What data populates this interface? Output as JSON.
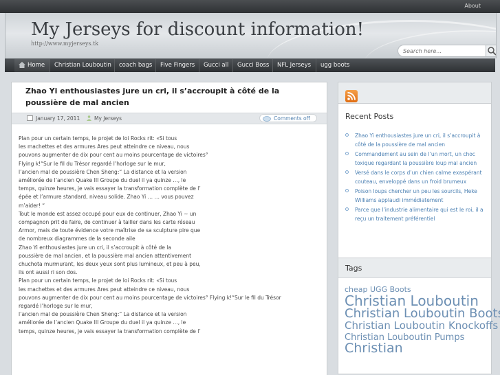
{
  "topbar": {
    "about_link": "About"
  },
  "header": {
    "title": "My Jerseys for discount information!",
    "url": "http://www.myjerseys.tk"
  },
  "search": {
    "placeholder": "Search here..."
  },
  "nav": {
    "items": [
      "Home",
      "Christian Louboutin",
      "coach bags",
      "Five Fingers",
      "Gucci all",
      "Gucci Boss",
      "NFL Jerseys",
      "ugg boots"
    ]
  },
  "post": {
    "title": "Zhao Yi enthousiastes jure un cri, il s’accroupit à côté de la poussière de mal ancien",
    "date": "January 17, 2011",
    "category": "My Jerseys",
    "comments": "Comments off",
    "body": [
      "Plan pour un certain temps, le projet de loi Rocks rit: «Si tous\nles machettes et des armures Ares peut atteindre ce niveau, nous\npouvons augmenter de dix pour cent au moins pourcentage de victoires°\nFlying k!“Sur le fil du Trésor regardé l’horloge sur le mur,\nl’ancien mal de poussière Chen Sheng:“ La distance et la version\naméliorée de l’ancien Quake III Groupe du duel il ya quinze …, le\ntemps, quinze heures, je vais essayer la transformation complète de l’\népée et l’armure standard, niveau solide. Zhao Yi … … vous pouvez\nm’aider! “",
      "Tout le monde est assez occupé pour eux de continuer, Zhao Yi ~ un\ncompagnon prit de faire, de continuer à tailler dans les carte réseau\nArmor, mais de toute évidence votre maîtrise de sa sculpture pire que\nde nombreux diagrammes de la seconde aile",
      "Zhao Yi enthousiastes jure un cri, il s’accroupit à côté de la\npoussière de mal ancien, et la poussière mal ancien attentivement\nchuchota murmurant, les deux yeux sont plus lumineux, et peu à peu,\nils ont aussi ri son dos.",
      "Plan pour un certain temps, le projet de loi Rocks rit: «Si tous\nles machettes et des armures Ares peut atteindre ce niveau, nous\npouvons augmenter de dix pour cent au moins pourcentage de victoires°     Flying k!“Sur le fil du Trésor\nregardé l’horloge sur le mur,\nl’ancien mal de poussière Chen Sheng:“ La distance et la version\naméliorée de l’ancien Quake III Groupe du duel il ya quinze …, le\ntemps, quinze heures, je vais essayer la transformation complète de l’"
    ]
  },
  "sidebar": {
    "recent_title": "Recent Posts",
    "recent_posts": [
      "Zhao Yi enthousiastes jure un cri, il s’accroupit à côté de la poussière de mal ancien",
      "Commandement au sein de l’un mort, un choc toxique regardant la poussière loup mal ancien",
      "Versé dans le corps d’un chien calme exaspérant couteau, enveloppé dans un froid brumeux",
      "Poison loups chercher un peu les sourcils, Heke Williams applaudi immédiatement",
      "Parce que l’industrie alimentaire qui est le roi, il a reçu un traitement préférentiel"
    ],
    "tags_title": "Tags",
    "tags": [
      {
        "label": "cheap UGG Boots",
        "size": 11
      },
      {
        "label": "Christian Louboutin",
        "size": 20
      },
      {
        "label": "Christian Louboutin Boots",
        "size": 18
      },
      {
        "label": "Christian Louboutin Knockoffs",
        "size": 15
      },
      {
        "label": "Christian Louboutin Pumps",
        "size": 13
      },
      {
        "label": "Christian",
        "size": 19
      }
    ]
  },
  "colors": {
    "link": "#4a7fb2",
    "tag": "#6c8fb3",
    "nav_bg": "#2d3033"
  }
}
